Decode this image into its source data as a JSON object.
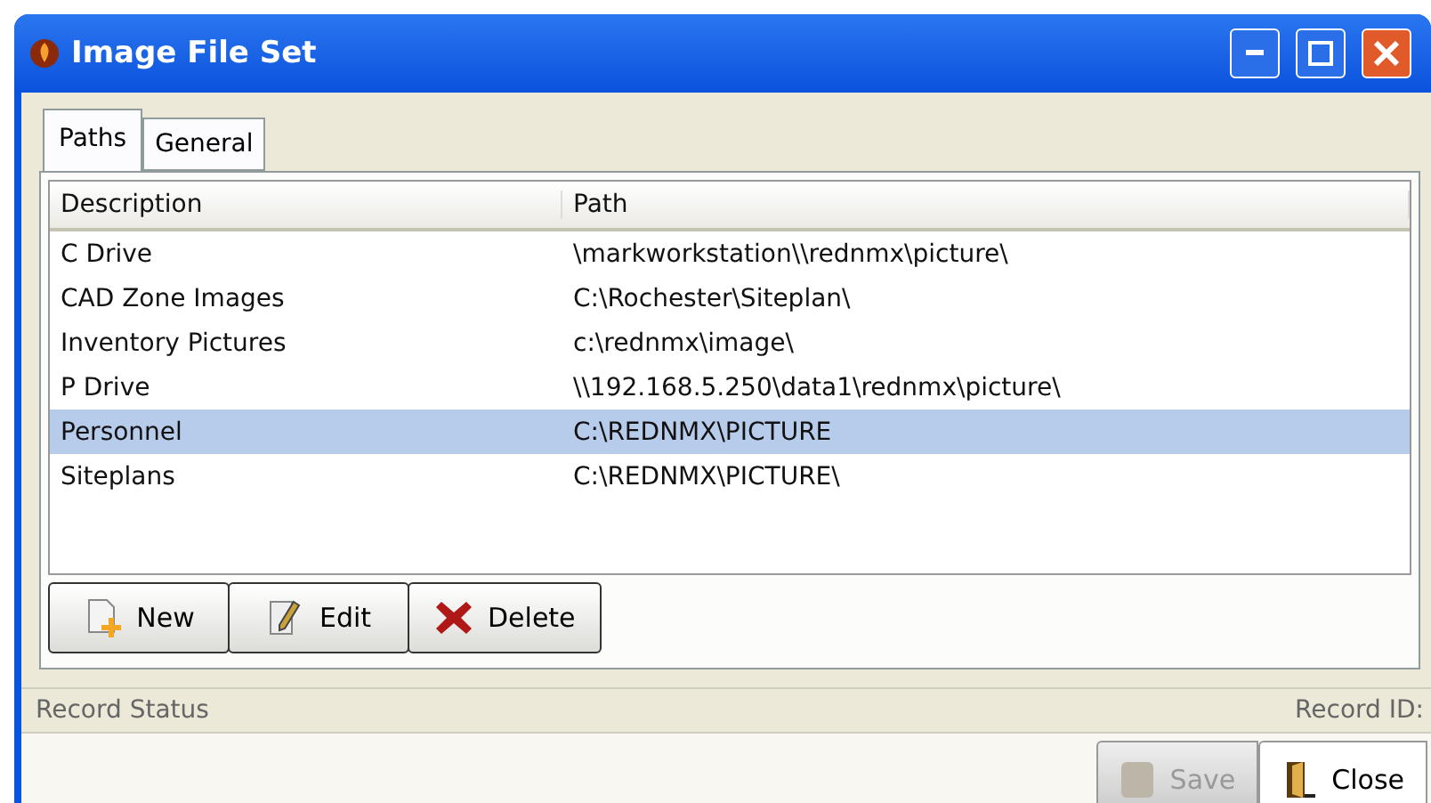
{
  "window": {
    "title": "Image File Set"
  },
  "tabs": [
    {
      "label": "Paths",
      "selected": true
    },
    {
      "label": "General",
      "selected": false
    }
  ],
  "table": {
    "columns": [
      "Description",
      "Path"
    ],
    "rows": [
      {
        "cells": [
          "C Drive",
          "\\markworkstation\\\\rednmx\\picture\\"
        ],
        "selected": false
      },
      {
        "cells": [
          "CAD Zone Images",
          "C:\\Rochester\\Siteplan\\"
        ],
        "selected": false
      },
      {
        "cells": [
          "Inventory Pictures",
          "c:\\rednmx\\image\\"
        ],
        "selected": false
      },
      {
        "cells": [
          "P Drive",
          "\\\\192.168.5.250\\data1\\rednmx\\picture\\"
        ],
        "selected": false
      },
      {
        "cells": [
          "Personnel",
          "C:\\REDNMX\\PICTURE"
        ],
        "selected": true
      },
      {
        "cells": [
          "Siteplans",
          "C:\\REDNMX\\PICTURE\\"
        ],
        "selected": false
      }
    ]
  },
  "list_buttons": [
    {
      "kind": "new",
      "label": "New"
    },
    {
      "kind": "edit",
      "label": "Edit"
    },
    {
      "kind": "delete",
      "label": "Delete"
    }
  ],
  "status_bar": {
    "status": "Record Status",
    "record_id": "Record ID:"
  },
  "footer_buttons": [
    {
      "kind": "save",
      "label": "Save",
      "disabled": true
    },
    {
      "kind": "close",
      "label": "Close",
      "disabled": false
    }
  ]
}
